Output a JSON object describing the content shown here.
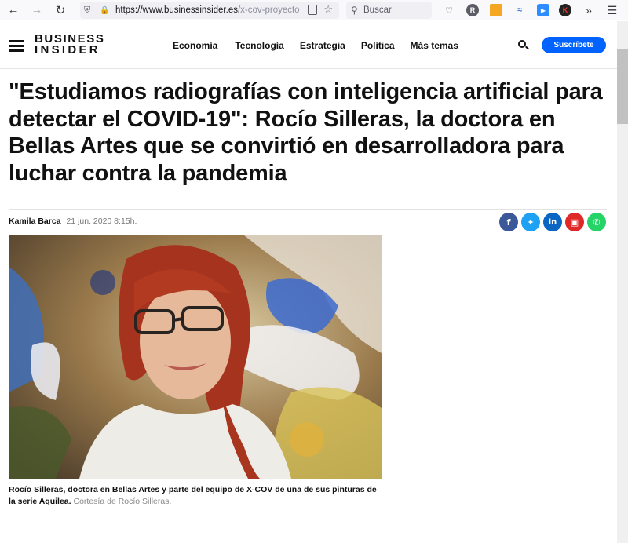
{
  "browser": {
    "url_main": "https://www.businessinsider.es",
    "url_path": "/x-cov-proyecto",
    "search_placeholder": "Buscar"
  },
  "site": {
    "logo_line1": "BUSINESS",
    "logo_line2": "INSIDER",
    "nav": [
      "Economía",
      "Tecnología",
      "Estrategia",
      "Política",
      "Más temas"
    ],
    "subscribe_label": "Suscríbete"
  },
  "article": {
    "headline": "\"Estudiamos radiografías con inteligencia artificial para detectar el COVID-19\": Rocío Silleras, la doctora en Bellas Artes que se convirtió en desarrolladora para luchar contra la pandemia",
    "author": "Kamila Barca",
    "date": "21 jun. 2020 8:15h.",
    "caption": "Rocío Silleras, doctora en Bellas Artes y parte del equipo de X-COV de una de sus pinturas de la serie Aquilea.",
    "credit": "Cortesía de Rocío Silleras."
  },
  "share_buttons": [
    {
      "name": "facebook",
      "glyph": "f",
      "color": "#3b5998"
    },
    {
      "name": "twitter",
      "glyph": "t",
      "color": "#1da1f2"
    },
    {
      "name": "linkedin",
      "glyph": "in",
      "color": "#0a66c2"
    },
    {
      "name": "flipboard",
      "glyph": "F",
      "color": "#e12828"
    },
    {
      "name": "whatsapp",
      "glyph": "w",
      "color": "#25d366"
    }
  ],
  "colors": {
    "subscribe": "#0062ff"
  }
}
